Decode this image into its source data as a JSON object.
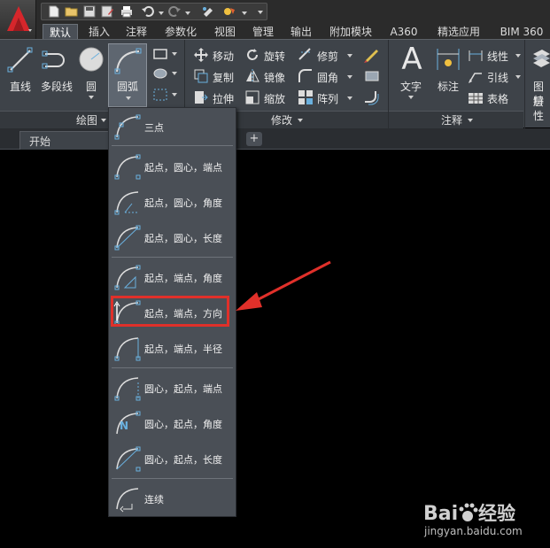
{
  "qat": {
    "icons": [
      "app-menu-icon",
      "new-icon",
      "open-icon",
      "save-icon",
      "save-as-icon",
      "print-icon",
      "undo-icon",
      "redo-icon",
      "match-properties-icon",
      "workspace-icon"
    ]
  },
  "tabs": [
    {
      "label": "默认",
      "active": true
    },
    {
      "label": "插入"
    },
    {
      "label": "注释"
    },
    {
      "label": "参数化"
    },
    {
      "label": "视图"
    },
    {
      "label": "管理"
    },
    {
      "label": "输出"
    },
    {
      "label": "附加模块"
    },
    {
      "label": "A360"
    },
    {
      "label": "精选应用"
    },
    {
      "label": "BIM 360"
    }
  ],
  "ribbon": {
    "draw": {
      "title": "绘图",
      "line": "直线",
      "polyline": "多段线",
      "circle": "圆",
      "arc": "圆弧"
    },
    "modify": {
      "title": "修改",
      "move": "移动",
      "rotate": "旋转",
      "trim": "修剪",
      "copy": "复制",
      "mirror": "镜像",
      "fillet": "圆角",
      "stretch": "拉伸",
      "scale": "缩放",
      "array": "阵列"
    },
    "annotation": {
      "title": "注释",
      "text": "文字",
      "dimension": "标注",
      "linear": "线性",
      "leader": "引线",
      "table": "表格"
    },
    "layers": {
      "label_top": "图层",
      "label_bottom": "特性"
    }
  },
  "filetabs": {
    "start": "开始",
    "add": "+"
  },
  "arc_menu": {
    "items": [
      {
        "label": "三点",
        "icon": "arc-3point-icon"
      },
      {
        "label": "起点，圆心，端点",
        "icon": "arc-start-center-end-icon"
      },
      {
        "label": "起点，圆心，角度",
        "icon": "arc-start-center-angle-icon"
      },
      {
        "label": "起点，圆心，长度",
        "icon": "arc-start-center-length-icon"
      },
      {
        "label": "起点，端点，角度",
        "icon": "arc-start-end-angle-icon"
      },
      {
        "label": "起点，端点，方向",
        "icon": "arc-start-end-direction-icon",
        "highlighted": true
      },
      {
        "label": "起点，端点，半径",
        "icon": "arc-start-end-radius-icon"
      },
      {
        "label": "圆心，起点，端点",
        "icon": "arc-center-start-end-icon"
      },
      {
        "label": "圆心，起点，角度",
        "icon": "arc-center-start-angle-icon"
      },
      {
        "label": "圆心，起点，长度",
        "icon": "arc-center-start-length-icon"
      },
      {
        "label": "连续",
        "icon": "arc-continue-icon"
      }
    ]
  },
  "annotation_color": "#e0302a",
  "watermark": {
    "brand_left": "Bai",
    "brand_right": "经验",
    "url": "jingyan.baidu.com"
  }
}
